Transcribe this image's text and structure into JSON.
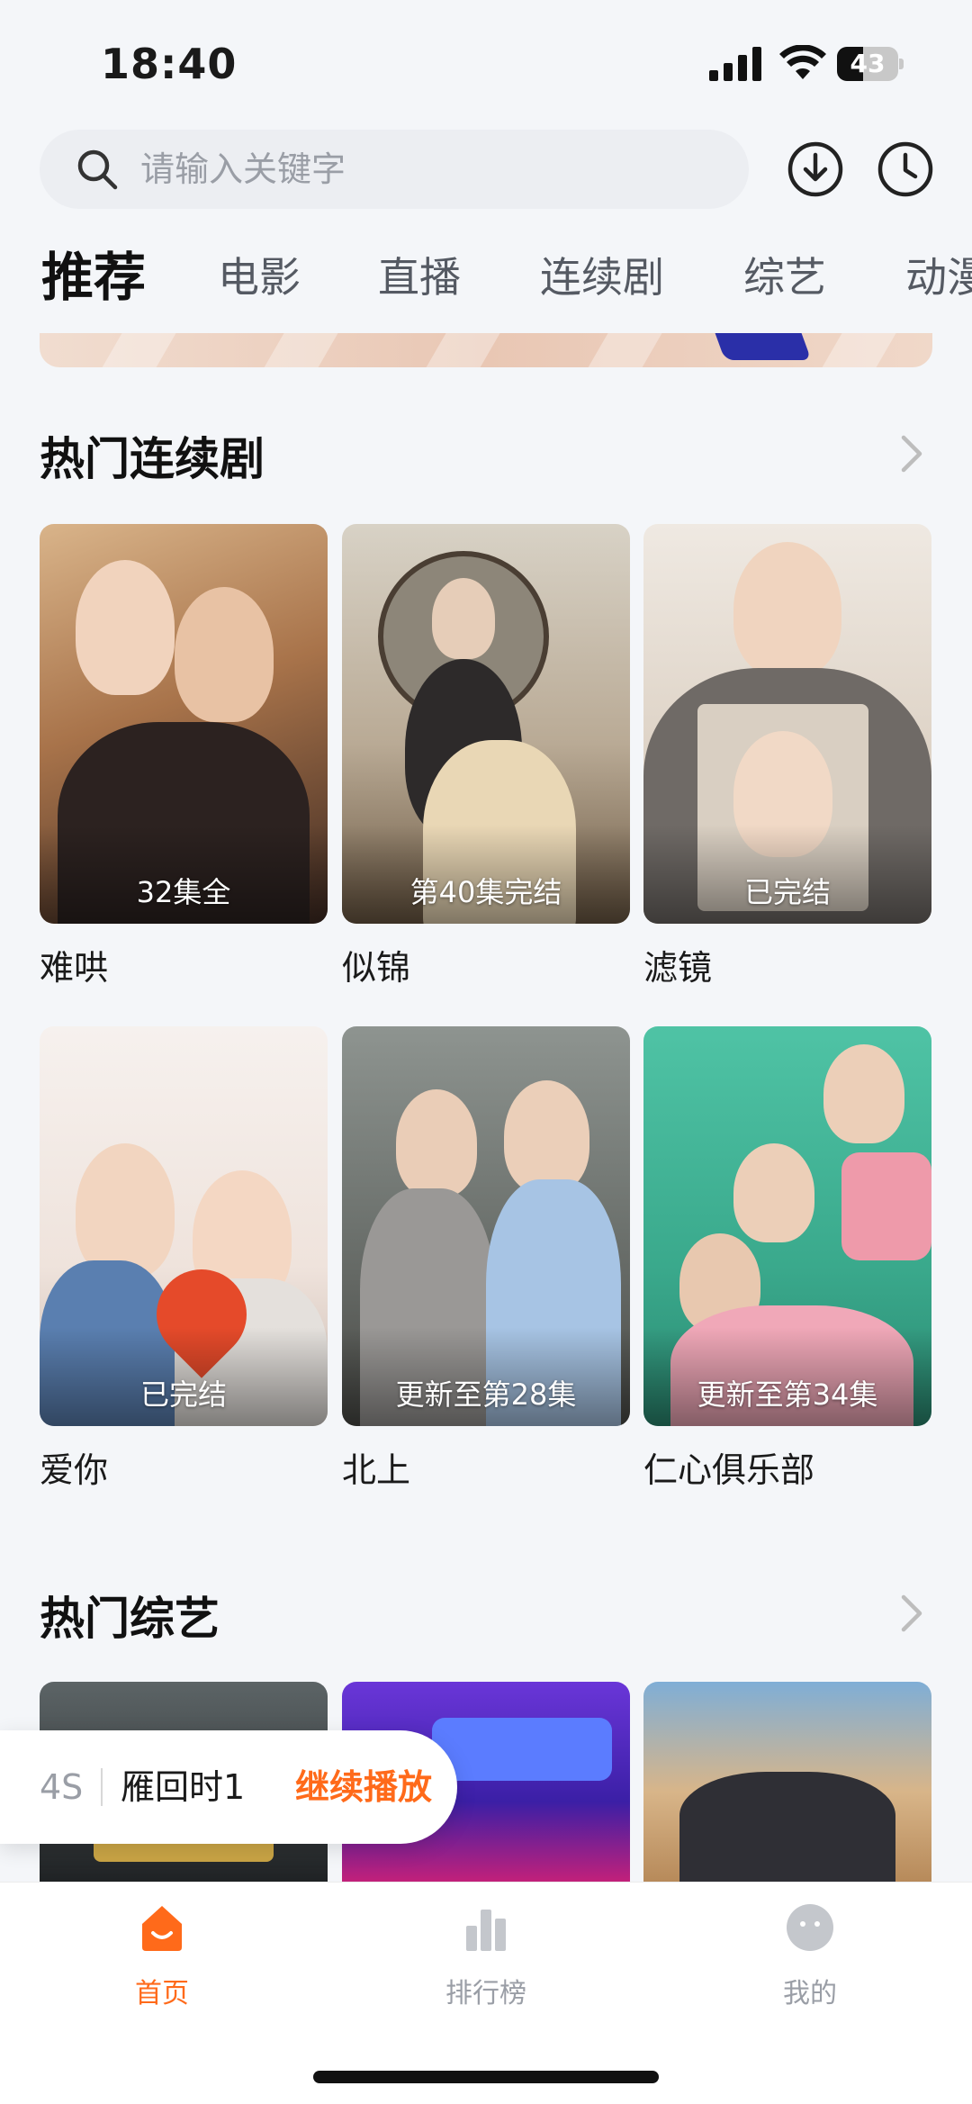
{
  "status_bar": {
    "time": "18:40",
    "battery": "43",
    "battery_fraction": 0.43
  },
  "search": {
    "placeholder": "请输入关键字"
  },
  "header_icons": [
    "download-icon",
    "history-clock-icon"
  ],
  "tabs": [
    {
      "label": "推荐",
      "active": true
    },
    {
      "label": "电影"
    },
    {
      "label": "直播"
    },
    {
      "label": "连续剧"
    },
    {
      "label": "综艺"
    },
    {
      "label": "动漫"
    }
  ],
  "section_dramas": {
    "title": "热门连续剧",
    "items": [
      {
        "title": "难哄",
        "badge": "32集全"
      },
      {
        "title": "似锦",
        "badge": "第40集完结"
      },
      {
        "title": "滤镜",
        "badge": "已完结"
      },
      {
        "title": "爱你",
        "badge": "已完结"
      },
      {
        "title": "北上",
        "badge": "更新至第28集"
      },
      {
        "title": "仁心俱乐部",
        "badge": "更新至第34集"
      }
    ]
  },
  "section_variety": {
    "title": "热门综艺"
  },
  "mini_player": {
    "prefix": "4S",
    "title": "雁回时1",
    "resume_label": "继续播放"
  },
  "bottom_nav": [
    {
      "label": "首页",
      "icon": "home-icon",
      "active": true
    },
    {
      "label": "排行榜",
      "icon": "ranking-icon"
    },
    {
      "label": "我的",
      "icon": "profile-icon"
    }
  ],
  "colors": {
    "accent": "#ff6a1a",
    "background": "#f4f6f9"
  }
}
